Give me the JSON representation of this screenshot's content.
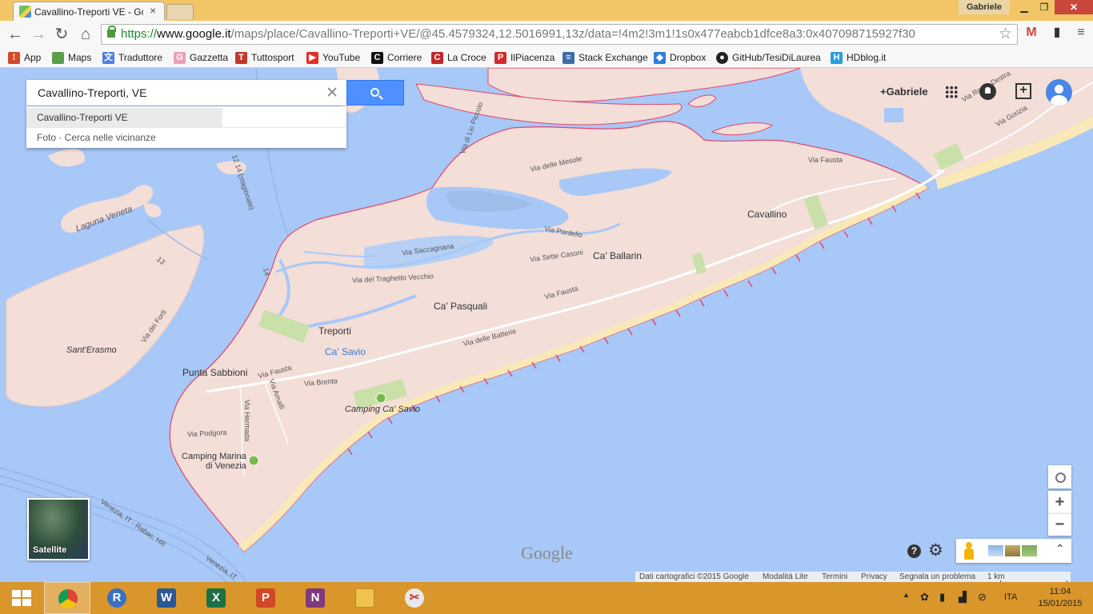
{
  "browser": {
    "tab_title": "Cavallino-Treporti VE - Go",
    "tab_close": "×",
    "user_name": "Gabriele",
    "url": {
      "scheme": "https://",
      "host": "www.google.it",
      "path": "/maps/place/Cavallino-Treporti+VE/@45.4579324,12.5016991,13z/data=!4m2!3m1!1s0x477eabcb1dfce8a3:0x407098715927f30"
    },
    "bookmarks": [
      {
        "label": "App",
        "color": "#d04a2b"
      },
      {
        "label": "Maps",
        "color": "#5a9e4b"
      },
      {
        "label": "Traduttore",
        "color": "#4a7ee0"
      },
      {
        "label": "Gazzetta",
        "color": "#e8a0b8"
      },
      {
        "label": "Tuttosport",
        "color": "#c0392b"
      },
      {
        "label": "YouTube",
        "color": "#e52d27"
      },
      {
        "label": "Corriere",
        "color": "#111111"
      },
      {
        "label": "La Croce",
        "color": "#c0262b"
      },
      {
        "label": "IlPiacenza",
        "color": "#d42a2a"
      },
      {
        "label": "Stack Exchange",
        "color": "#3d6ba8"
      },
      {
        "label": "Dropbox",
        "color": "#2f7fd8"
      },
      {
        "label": "GitHub/TesiDiLaurea",
        "color": "#222222"
      },
      {
        "label": "HDblog.it",
        "color": "#2a9ed8"
      }
    ]
  },
  "search": {
    "query": "Cavallino-Treporti, VE",
    "suggestions": [
      "Cavallino-Treporti VE",
      "Foto · Cerca nelle vicinanze"
    ]
  },
  "top_right": {
    "gplus": "+Gabriele"
  },
  "map_labels": {
    "cavallino": "Cavallino",
    "ca_ballarin": "Ca' Ballarin",
    "ca_pasquali": "Ca' Pasquali",
    "treporti": "Treporti",
    "ca_savio": "Ca' Savio",
    "punta_sabbioni": "Punta Sabbioni",
    "camping_ca_savio": "Camping Ca' Savio",
    "camping_marina_1": "Camping Marina",
    "camping_marina_2": "di Venezia",
    "sant_erasmo": "Sant'Erasmo",
    "laguna_veneta": "Laguna Veneta",
    "via_fausta_1": "Via Fausta",
    "via_fausta_2": "Via Fausta",
    "via_fausta_3": "Via Fausta",
    "via_pordelio": "Via Pordelio",
    "via_sette_casoni": "Via Sette Casoni",
    "via_saccagnana": "Via Saccagnana",
    "via_traghetto": "Via del Traghetto Vecchio",
    "via_batterie": "Via delle Batterie",
    "via_brenta": "Via Brenta",
    "via_amalfi": "Via Amalfi",
    "via_hermada": "Via Hermada",
    "via_podgora": "Via Podgora",
    "via_mesole": "Via delle Mesole",
    "via_lio_piccolo": "Via di Lio Piccolo",
    "via_forti": "Via dei Forti",
    "via_roma_destra": "Via Roma Destra",
    "via_gorizia": "Via Gorizia",
    "ferry_12_14": "12 14 (stagionale)",
    "ferry_13": "13",
    "ferry_14": "14",
    "ferry_venezia_1": "Venezia, IT - Rabac, HR",
    "ferry_venezia_2": "Venezia, IT"
  },
  "controls": {
    "zoom_in": "+",
    "zoom_out": "−",
    "help": "?",
    "satellite": "Satellite",
    "wordmark": "Google"
  },
  "footer": {
    "data": "Dati cartografici ©2015 Google",
    "lite": "Modalità Lite",
    "terms": "Termini",
    "privacy": "Privacy",
    "report": "Segnala un problema",
    "scale": "1 km"
  },
  "taskbar": {
    "apps": [
      {
        "name": "chrome",
        "glyph": "",
        "color": "#db4437",
        "active": true
      },
      {
        "name": "r",
        "glyph": "R",
        "color": "#3a6fc4",
        "active": false
      },
      {
        "name": "word",
        "glyph": "W",
        "color": "#2b5797",
        "active": false
      },
      {
        "name": "excel",
        "glyph": "X",
        "color": "#1e7145",
        "active": false
      },
      {
        "name": "powerpoint",
        "glyph": "P",
        "color": "#d24726",
        "active": false
      },
      {
        "name": "onenote",
        "glyph": "N",
        "color": "#80397b",
        "active": false
      },
      {
        "name": "explorer",
        "glyph": "",
        "color": "#f0c350",
        "active": false
      },
      {
        "name": "snipping",
        "glyph": "",
        "color": "#e0e0e0",
        "active": false
      }
    ],
    "language": "ITA",
    "time": "11:04",
    "date": "15/01/2015"
  },
  "colors": {
    "water": "#a8c8f7",
    "land": "#f3ded8",
    "border": "#e2466a",
    "beach": "#fae9b8",
    "green": "#c9e0a8"
  }
}
